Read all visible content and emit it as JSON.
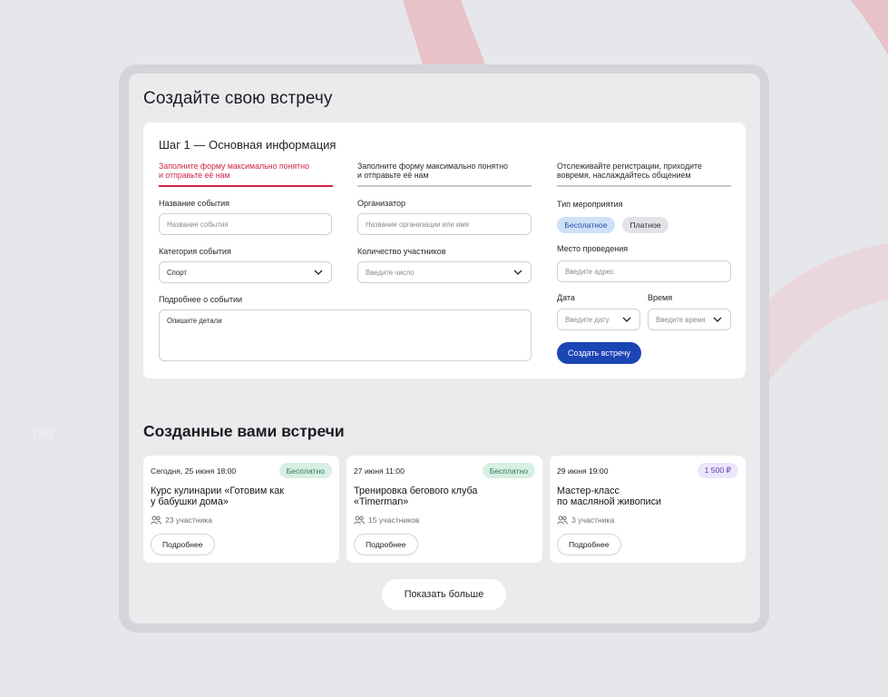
{
  "side_label": "768",
  "page_title": "Создайте свою встречу",
  "form": {
    "step_title": "Шаг 1  — Основная информация",
    "tabs": [
      {
        "line1": "Заполните форму максимально понятно",
        "line2": "и отправьте её нам",
        "active": true
      },
      {
        "line1": "Заполните форму максимально понятно",
        "line2": "и отправьте её нам",
        "active": false
      },
      {
        "line1": "Отслеживайте регистрации, приходите",
        "line2": "вовремя, наслаждайтесь общением",
        "active": false
      }
    ],
    "event_name": {
      "label": "Название события",
      "placeholder": "Название события"
    },
    "category": {
      "label": "Категория события",
      "value": "Спорт"
    },
    "details": {
      "label": "Подробнее о событии",
      "placeholder": "Опишите детали"
    },
    "organizer": {
      "label": "Организатор",
      "placeholder": "Название организации или имя"
    },
    "participants": {
      "label": "Количество участников",
      "placeholder": "Введите число"
    },
    "event_type": {
      "label": "Тип мероприятия",
      "options": [
        "Бесплатное",
        "Платное"
      ],
      "selected": "Бесплатное"
    },
    "venue": {
      "label": "Место проведения",
      "placeholder": "Введите адрес"
    },
    "date": {
      "label": "Дата",
      "placeholder": "Введите дату"
    },
    "time": {
      "label": "Время",
      "placeholder": "Введите время"
    },
    "submit_label": "Создать встречу"
  },
  "created": {
    "title": "Созданные вами встречи",
    "events": [
      {
        "date": "Сегодня, 25 июня 18:00",
        "badge": "Бесплатно",
        "name": "Курс кулинарии «Готовим как\n у бабушки дома»",
        "participants": "23 участника",
        "more": "Подробнее"
      },
      {
        "date": "27 июня 11:00",
        "badge": "Бесплатно",
        "name": "Тренировка бегового клуба\n«Timerman»",
        "participants": "15 участников",
        "more": "Подробнее"
      },
      {
        "date": "29 июня 19:00",
        "badge": "1 500 ₽",
        "name": "Мастер-класс\nпо масляной живописи",
        "participants": "3 участника",
        "more": "Подробнее"
      }
    ],
    "show_more": "Показать больше"
  },
  "colors": {
    "accent": "#d0244a",
    "primary_button": "#1c45b4",
    "free_badge": "#d7efe4",
    "price_badge": "#ebe6fb",
    "background": "#e6e7eb"
  },
  "icons": {
    "participants": "people-icon",
    "dropdown": "chevron-down-icon"
  }
}
